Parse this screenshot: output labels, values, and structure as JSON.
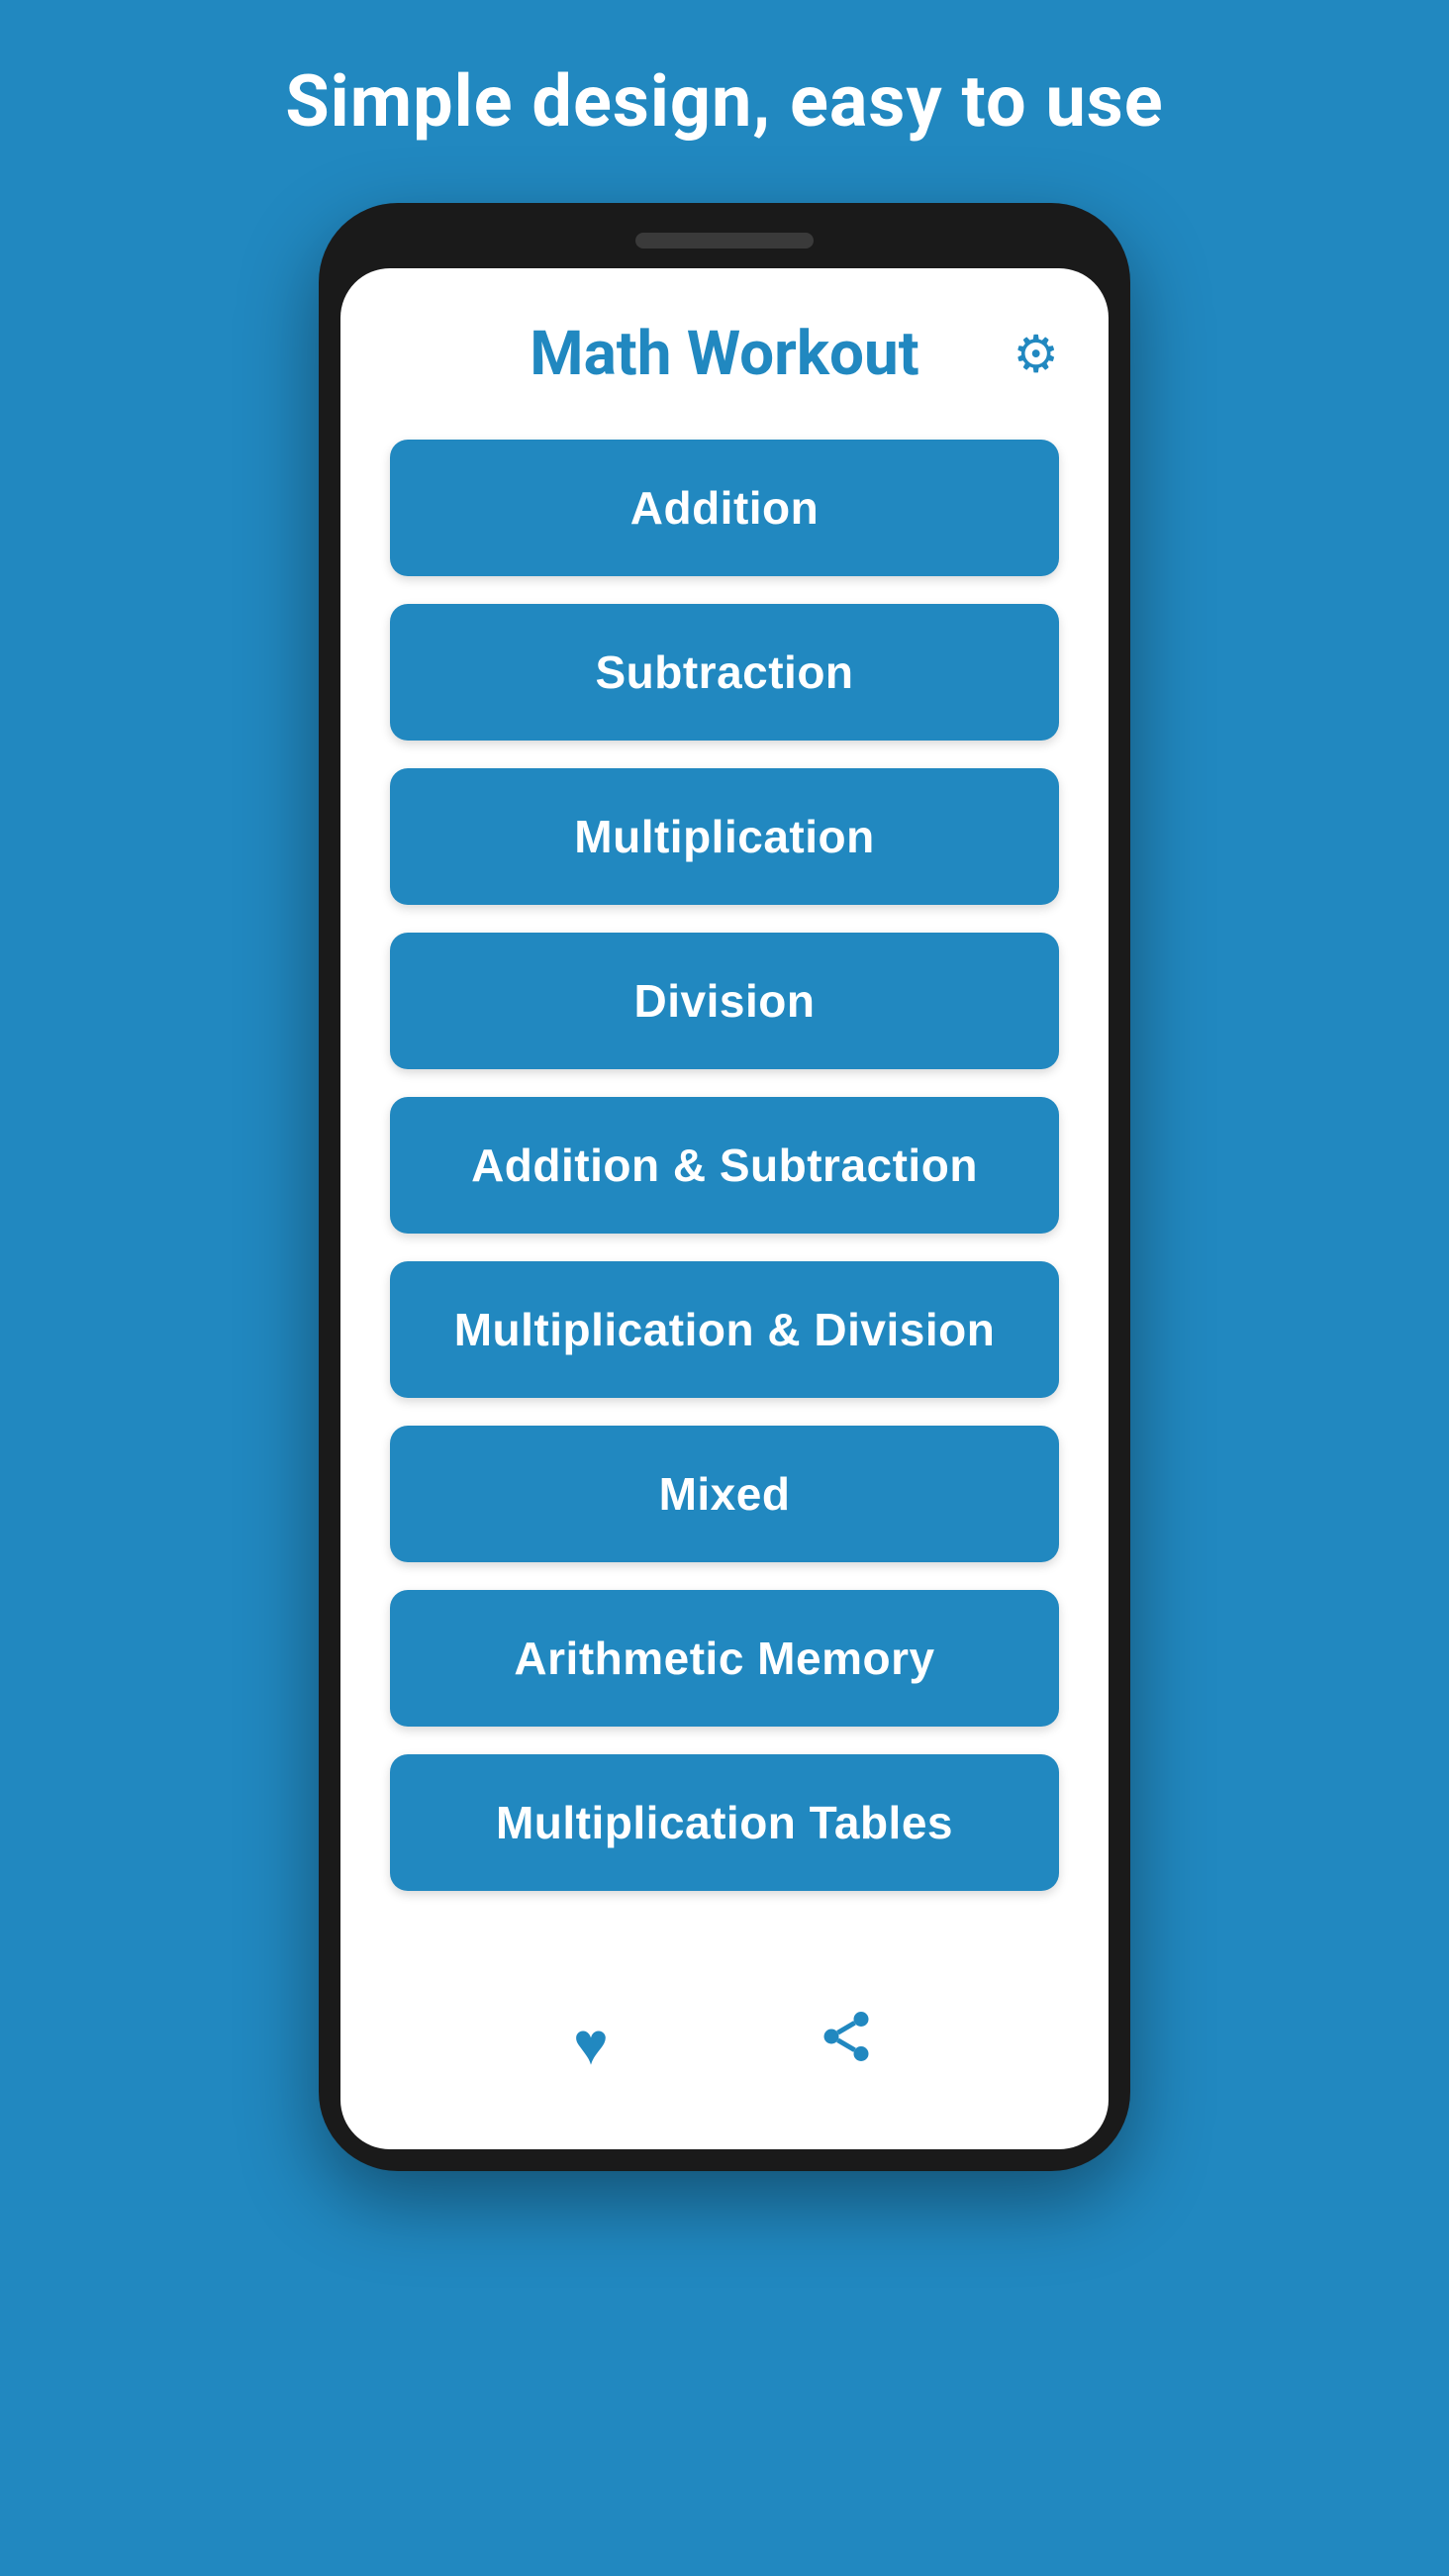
{
  "page": {
    "headline": "Simple design, easy to use",
    "background_color": "#2188c0"
  },
  "phone": {
    "app_title": "Math Workout",
    "settings_icon": "⚙",
    "menu_buttons": [
      {
        "label": "Addition",
        "id": "addition"
      },
      {
        "label": "Subtraction",
        "id": "subtraction"
      },
      {
        "label": "Multiplication",
        "id": "multiplication"
      },
      {
        "label": "Division",
        "id": "division"
      },
      {
        "label": "Addition & Subtraction",
        "id": "addition-subtraction"
      },
      {
        "label": "Multiplication & Division",
        "id": "multiplication-division"
      },
      {
        "label": "Mixed",
        "id": "mixed"
      },
      {
        "label": "Arithmetic Memory",
        "id": "arithmetic-memory"
      },
      {
        "label": "Multiplication Tables",
        "id": "multiplication-tables"
      }
    ],
    "bottom_bar": {
      "heart_icon": "♥",
      "share_icon": "⤴"
    }
  }
}
